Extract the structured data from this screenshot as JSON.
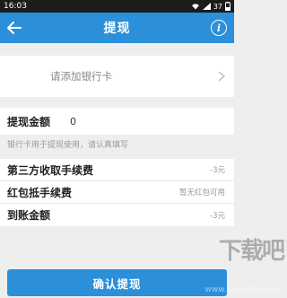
{
  "status_bar": {
    "time": "16:03",
    "battery": "37"
  },
  "header": {
    "title": "提现",
    "back_icon": "arrow-left-icon",
    "info_icon": "info-icon",
    "info_glyph": "i",
    "color": "#2c8fd9"
  },
  "bank_card": {
    "label": "请添加银行卡",
    "chevron_icon": "chevron-right-icon"
  },
  "amount": {
    "label": "提现金额",
    "value": "0"
  },
  "hint": "银行卡用于提现使用，请认真填写",
  "fees": [
    {
      "label": "第三方收取手续费",
      "value": "-3元"
    },
    {
      "label": "红包抵手续费",
      "value": "暂无红包可用"
    },
    {
      "label": "到账金额",
      "value": "-3元"
    }
  ],
  "confirm_button": {
    "label": "确认提现"
  },
  "watermark": {
    "text": "下载吧",
    "url": "www.xiazaiba.com"
  }
}
